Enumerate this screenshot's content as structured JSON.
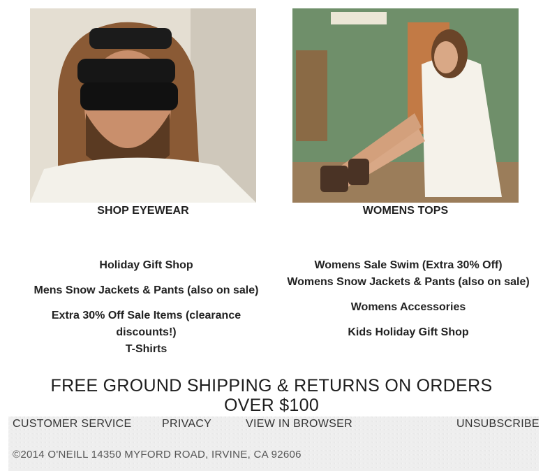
{
  "promos": [
    {
      "label": "SHOP EYEWEAR"
    },
    {
      "label": "WOMENS TOPS"
    }
  ],
  "links_left": [
    "Holiday Gift Shop",
    "Mens Snow Jackets & Pants (also on sale)",
    "Extra 30% Off Sale Items (clearance discounts!)",
    "T-Shirts"
  ],
  "links_right": [
    "Womens Sale Swim (Extra 30% Off)",
    "Womens Snow Jackets & Pants (also on sale)",
    "Womens Accessories",
    "Kids Holiday Gift Shop"
  ],
  "shipping_banner": "FREE GROUND SHIPPING & RETURNS ON ORDERS OVER $100",
  "footer": {
    "nav": [
      "CUSTOMER SERVICE",
      "PRIVACY",
      "VIEW IN BROWSER",
      "UNSUBSCRIBE"
    ],
    "copyright": "©2014 O'NEILL 14350 MYFORD ROAD, IRVINE, CA 92606"
  }
}
